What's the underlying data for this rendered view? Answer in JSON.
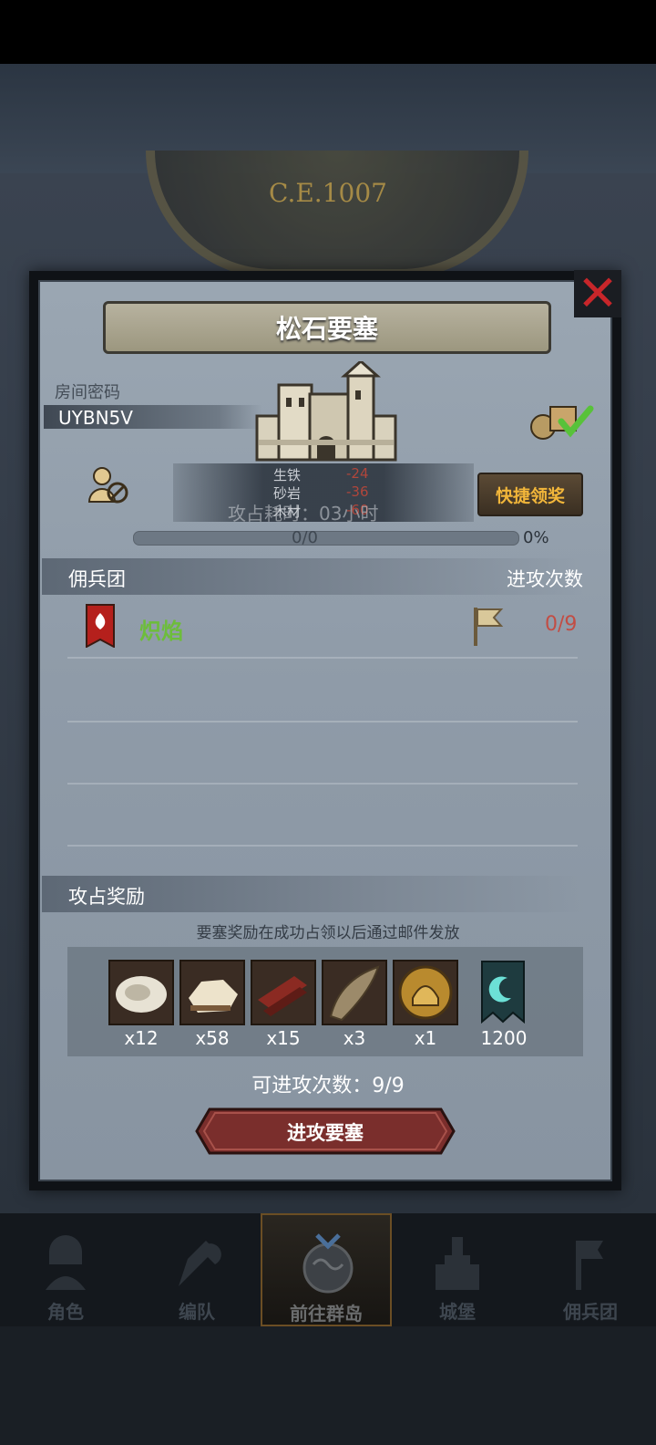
{
  "scene": {
    "era": "C.E.1007"
  },
  "dialog": {
    "title": "松石要塞",
    "room_label": "房间密码",
    "room_code": "UYBN5V",
    "resources": [
      {
        "name": "生铁",
        "value": "-24"
      },
      {
        "name": "砂岩",
        "value": "-36"
      },
      {
        "name": "木材",
        "value": "-60"
      }
    ],
    "occupy_time": "攻占耗时：03小时",
    "quick_claim_label": "快捷领奖",
    "progress": {
      "text": "0/0",
      "percent_label": "0%",
      "fraction": 0
    },
    "mercenary": {
      "header_title": "佣兵团",
      "header_attacks": "进攻次数",
      "teams": [
        {
          "name": "炽焰",
          "count": "0/9"
        }
      ]
    },
    "reward": {
      "title": "攻占奖励",
      "note": "要塞奖励在成功占领以后通过邮件发放",
      "items": [
        {
          "icon": "fur-icon",
          "qty": "x12"
        },
        {
          "icon": "hide-icon",
          "qty": "x58"
        },
        {
          "icon": "wood-plank-icon",
          "qty": "x15"
        },
        {
          "icon": "horn-icon",
          "qty": "x3"
        },
        {
          "icon": "knight-helmet-icon",
          "qty": "x1"
        },
        {
          "icon": "guild-banner-icon",
          "qty": "1200"
        }
      ]
    },
    "attacks_left": "可进攻次数：9/9",
    "attack_button": "进攻要塞"
  },
  "nav": {
    "items": [
      {
        "label": "角色",
        "icon": "knight-icon"
      },
      {
        "label": "编队",
        "icon": "formation-icon"
      },
      {
        "label": "前往群岛",
        "icon": "island-icon"
      },
      {
        "label": "城堡",
        "icon": "castle-icon"
      },
      {
        "label": "佣兵团",
        "icon": "mercenary-icon"
      }
    ]
  },
  "colors": {
    "accent_gold": "#f2b63a",
    "team_green": "#6dbd3b",
    "count_red": "#c24d44",
    "close_red": "#c8262a"
  }
}
